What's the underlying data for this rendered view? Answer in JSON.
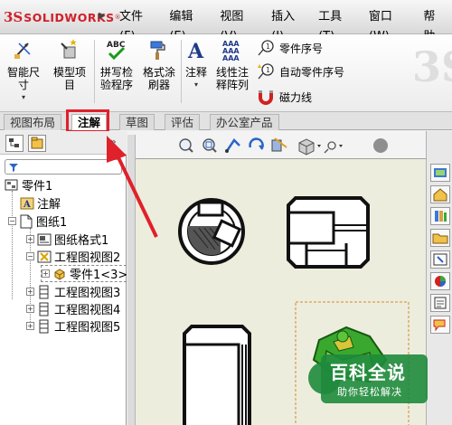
{
  "app": {
    "logo_prefix": "3S",
    "logo_text": "SOLIDWORKS",
    "logo_reg": "®"
  },
  "menu": [
    "文件(F)",
    "编辑(E)",
    "视图(V)",
    "插入(I)",
    "工具(T)",
    "窗口(W)",
    "帮助"
  ],
  "ribbon": {
    "smart_dimension": "智能尺\n寸",
    "model_items": "模型项\n目",
    "spell_check": "拼写检\n验程序",
    "format_painter": "格式涂\n刷器",
    "note": "注释",
    "linear_note_pattern": "线性注\n释阵列",
    "balloon": "零件序号",
    "auto_balloon": "自动零件序号",
    "magnetic_line": "磁力线",
    "abc_label": "ABC",
    "aaa_label": "AAA"
  },
  "tabs": [
    {
      "label": "视图布局",
      "active": false
    },
    {
      "label": "注解",
      "active": true
    },
    {
      "label": "草图",
      "active": false
    },
    {
      "label": "评估",
      "active": false
    },
    {
      "label": "办公室产品",
      "active": false
    }
  ],
  "tree": {
    "root": "零件1",
    "annotations": "注解",
    "sheet": "图纸1",
    "sheet_format": "图纸格式1",
    "view2": "工程图视图2",
    "part_ref": "零件1<3>",
    "view3": "工程图视图3",
    "view4": "工程图视图4",
    "view5": "工程图视图5"
  },
  "watermark": {
    "main": "百科全说",
    "sub": "助你轻松解决"
  },
  "colors": {
    "highlight": "#e0202a",
    "brand": "#d0202a",
    "part_green": "#3aa82e"
  }
}
